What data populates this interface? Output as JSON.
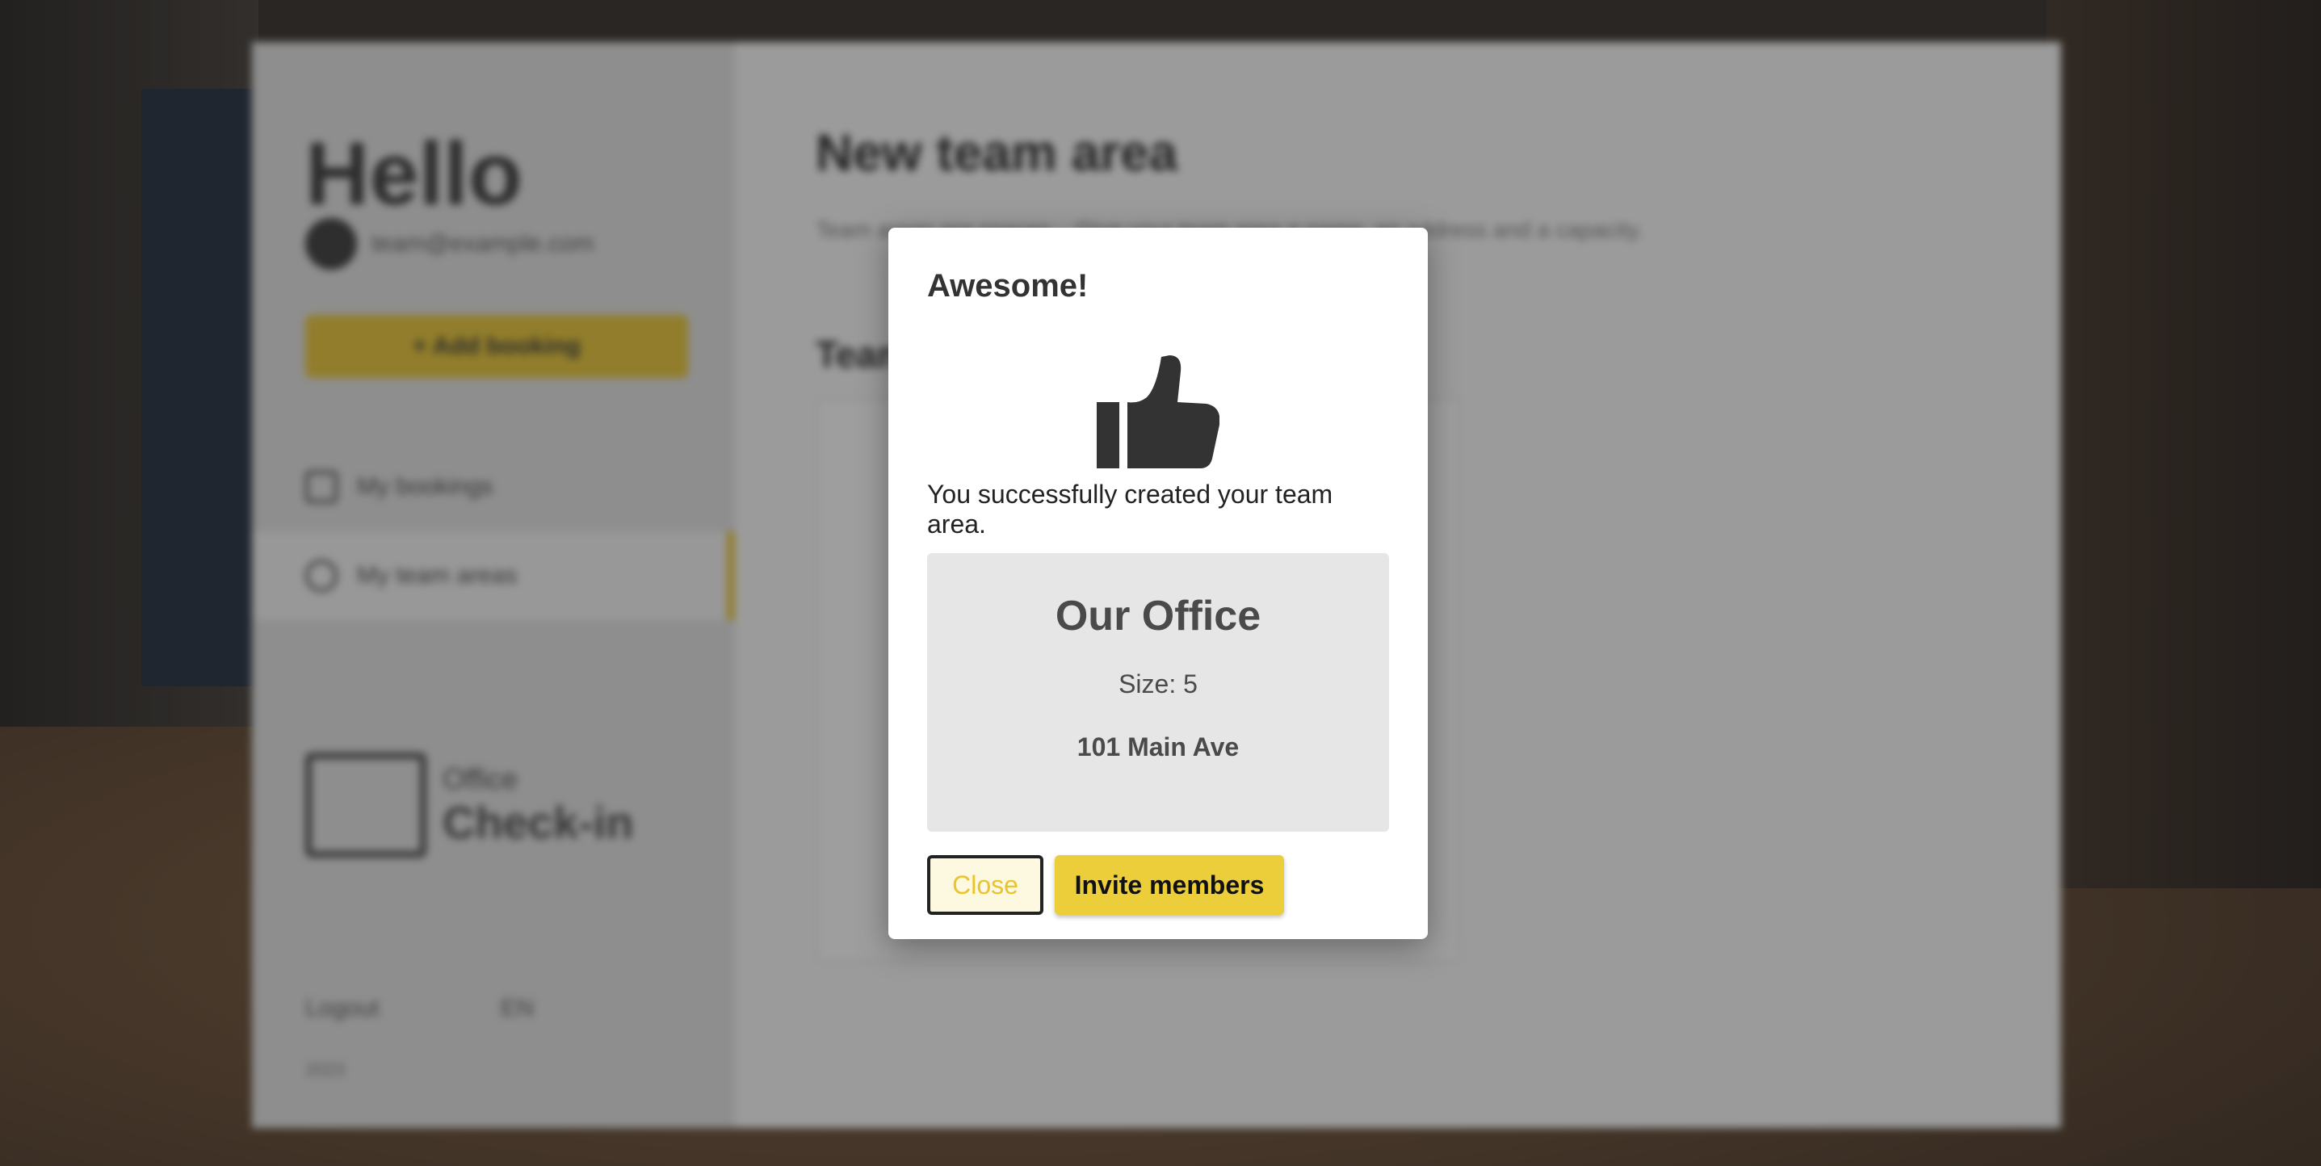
{
  "background_app": {
    "sidebar": {
      "greeting": "Hello",
      "user_email": "team@example.com",
      "add_booking_label": "+ Add booking",
      "items": [
        {
          "label": "My bookings"
        },
        {
          "label": "My team areas"
        }
      ],
      "logo": {
        "small": "Office",
        "big": "Check-in"
      },
      "logout_label": "Logout",
      "language_label": "EN",
      "year": "2023"
    },
    "main": {
      "title": "New team area",
      "description": "Team areas are spaces... Give your team area a name, an address and a capacity.",
      "subtitle": "Team"
    }
  },
  "modal": {
    "title": "Awesome!",
    "icon": "thumbs-up-icon",
    "message": "You successfully created your team area.",
    "card": {
      "name": "Our Office",
      "size": "Size: 5",
      "address": "101 Main Ave"
    },
    "buttons": {
      "close": "Close",
      "invite": "Invite members"
    }
  },
  "colors": {
    "accent": "#eccd3a",
    "text_dark": "#333333",
    "card_bg": "#e6e6e6"
  }
}
